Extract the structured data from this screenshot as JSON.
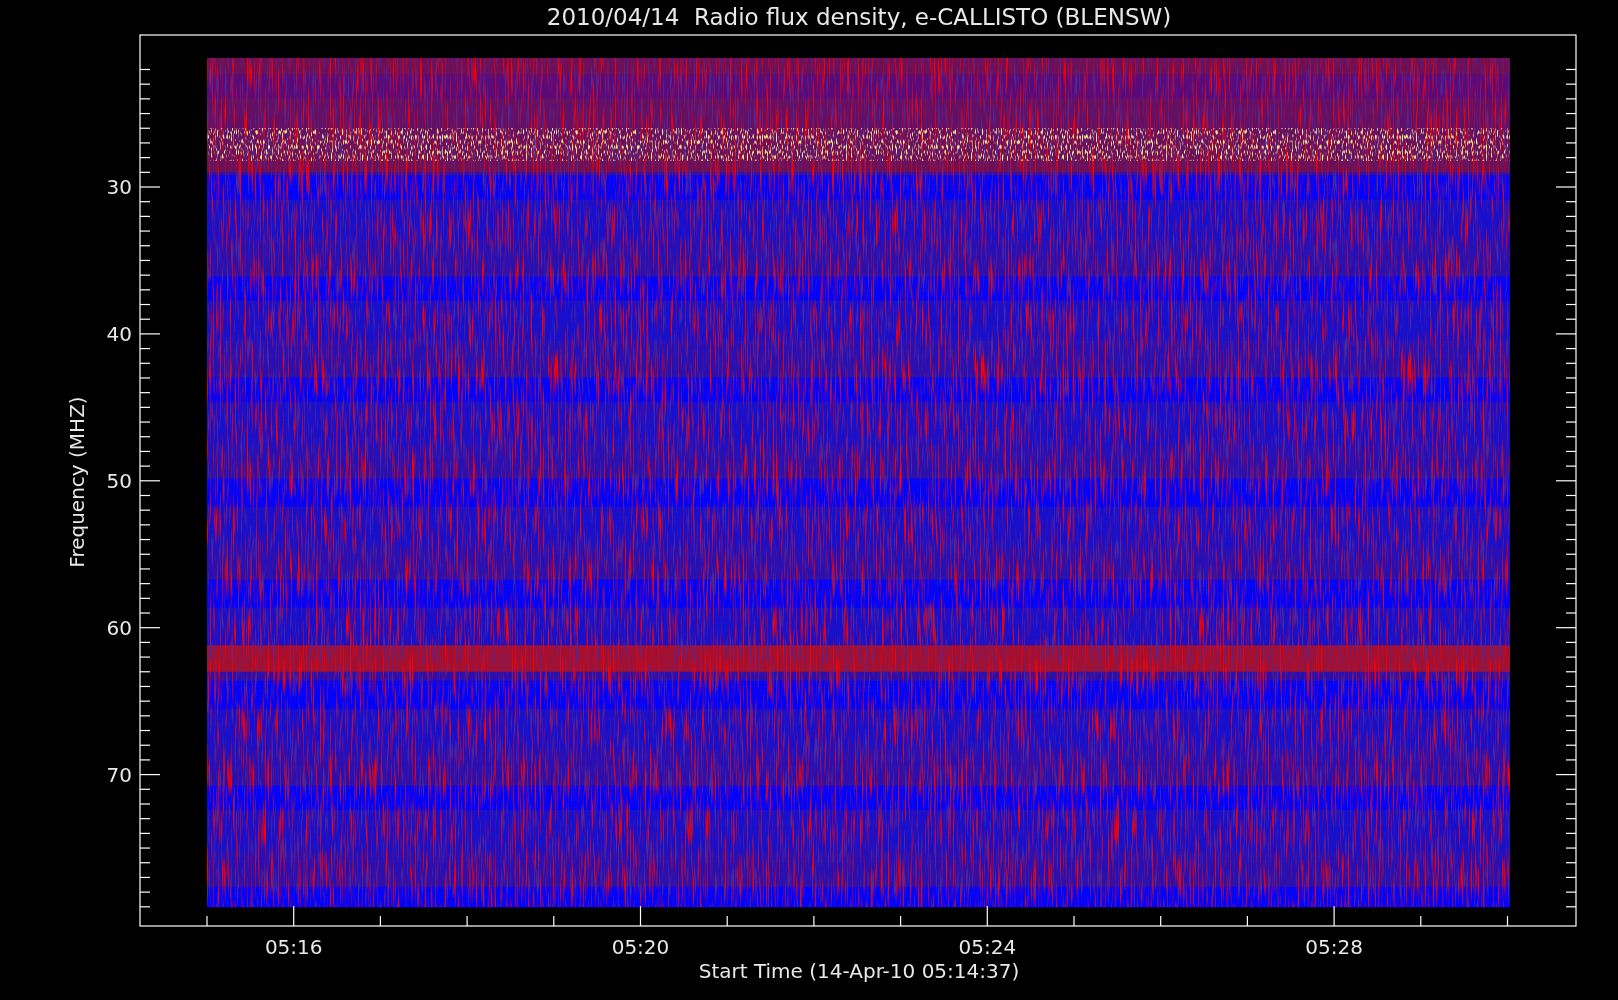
{
  "title": "2010/04/14  Radio flux density, e-CALLISTO (BLENSW)",
  "y_axis": {
    "label": "Frequency (MHZ)",
    "ticks": [
      "30",
      "40",
      "50",
      "60",
      "70"
    ]
  },
  "x_axis": {
    "label": "Start Time (14-Apr-10 05:14:37)",
    "ticks": [
      "05:16",
      "05:20",
      "05:24",
      "05:28"
    ]
  }
}
